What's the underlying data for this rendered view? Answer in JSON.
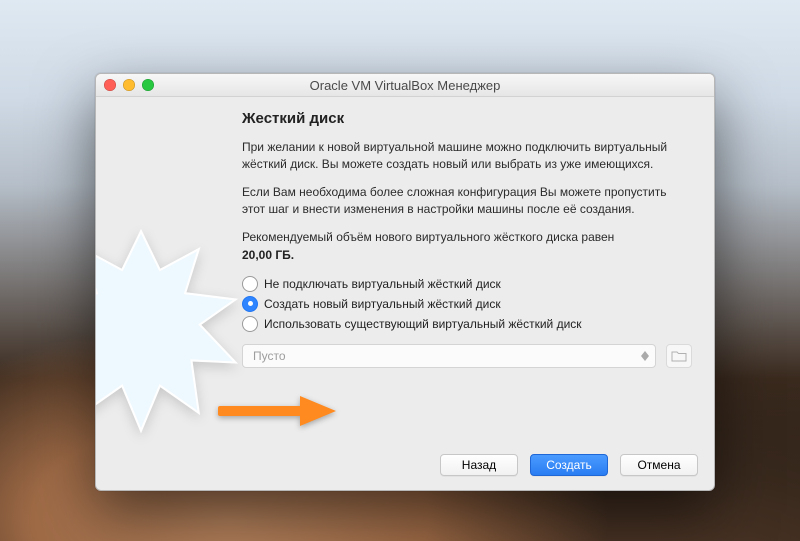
{
  "window": {
    "title": "Oracle VM VirtualBox Менеджер"
  },
  "section": {
    "title": "Жесткий диск",
    "para1": "При желании к новой виртуальной машине можно подключить виртуальный жёсткий диск. Вы можете создать новый или выбрать из уже имеющихся.",
    "para2": "Если Вам необходима более сложная конфигурация Вы можете пропустить этот шаг и внести изменения в настройки машины после её создания.",
    "reco_line": "Рекомендуемый объём нового виртуального жёсткого диска равен",
    "reco_size": "20,00 ГБ."
  },
  "options": {
    "opt0": {
      "label": "Не подключать виртуальный жёсткий диск",
      "selected": false
    },
    "opt1": {
      "label": "Создать новый виртуальный жёсткий диск",
      "selected": true
    },
    "opt2": {
      "label": "Использовать существующий виртуальный жёсткий диск",
      "selected": false
    }
  },
  "existing_select": {
    "value": "Пусто",
    "enabled": false
  },
  "buttons": {
    "back": "Назад",
    "create": "Создать",
    "cancel": "Отмена"
  }
}
